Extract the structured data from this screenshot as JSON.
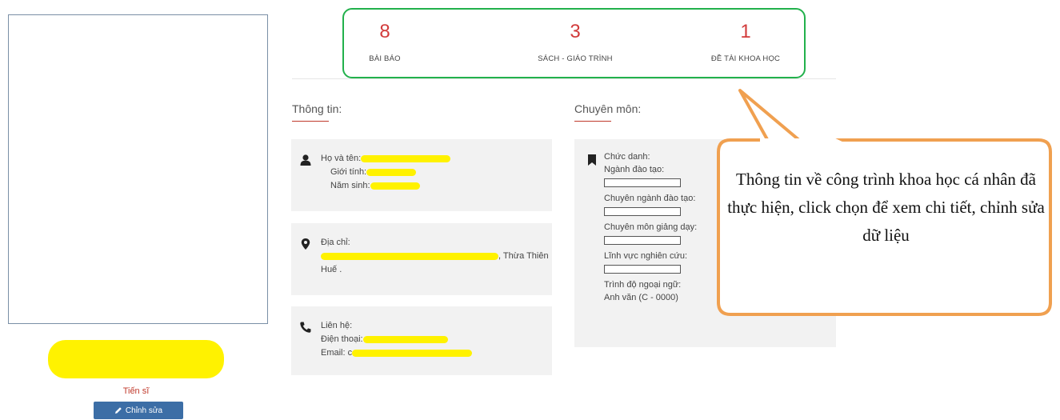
{
  "profile": {
    "degree": "Tiến sĩ",
    "edit_label": "Chỉnh sửa"
  },
  "stats": [
    {
      "value": "8",
      "label": "BÀI BÁO"
    },
    {
      "value": "3",
      "label": "SÁCH - GIÁO TRÌNH"
    },
    {
      "value": "1",
      "label": "ĐỀ TÀI KHOA HỌC"
    }
  ],
  "info": {
    "title": "Thông tin:",
    "personal": {
      "name_label": "Họ và tên:",
      "gender_label": "Giới tính:",
      "birth_year_label": "Năm sinh:"
    },
    "address": {
      "label": "Địa chỉ:",
      "value_tail": ", Thừa Thiên",
      "value_line2": "Huế ."
    },
    "contact": {
      "label": "Liên hệ:",
      "phone_label": "Điện thoại:",
      "email_label": "Email: c"
    }
  },
  "expertise": {
    "title": "Chuyên môn:",
    "rank_label": "Chức danh:",
    "training_label": "Ngành đào tạo:",
    "specialization_label": "Chuyên ngành đào tạo:",
    "teaching_label": "Chuyên môn giảng dạy:",
    "research_label": "Lĩnh vực nghiên cứu:",
    "language_label": "Trình độ ngoại ngữ:",
    "language_value": "Anh văn (C - 0000)"
  },
  "callout": {
    "text": "Thông tin về công trình khoa học cá nhân đã thực hiện, click chọn để xem chi tiết, chỉnh sửa dữ liệu"
  },
  "colors": {
    "accent_red": "#d23b3b",
    "green_border": "#22b14c",
    "callout_border": "#f0a050",
    "highlight": "#fff200",
    "button_blue": "#3c6ea6"
  }
}
